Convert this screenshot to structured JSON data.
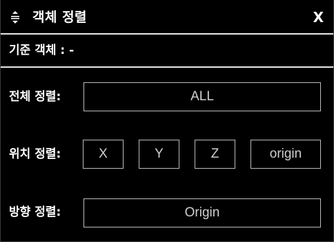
{
  "panel": {
    "title": "객체 정렬",
    "close_label": "X"
  },
  "target": {
    "label": "기준 객체 : -"
  },
  "overall_align": {
    "label": "전체 정렬:",
    "button": "ALL"
  },
  "position_align": {
    "label": "위치 정렬:",
    "buttons": [
      "X",
      "Y",
      "Z",
      "origin"
    ]
  },
  "direction_align": {
    "label": "방향 정렬:",
    "button": "Origin"
  },
  "icons": {
    "drag": "drag-handle-icon"
  },
  "colors": {
    "background": "#000000",
    "text": "#ffffff",
    "button_border": "#bdbdbd",
    "button_text": "#cfcfcf"
  }
}
